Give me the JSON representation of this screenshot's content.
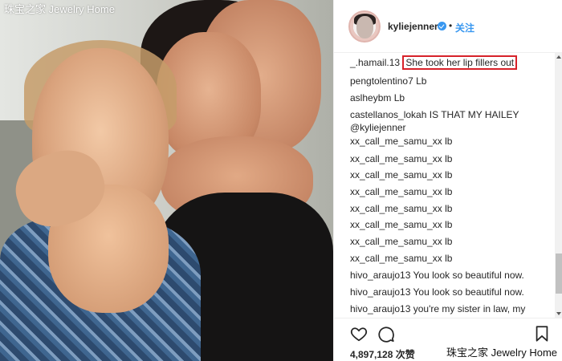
{
  "watermark": {
    "top_left": "珠宝之家 Jewelry Home",
    "bottom_right": "珠宝之家 Jewelry Home"
  },
  "post": {
    "username": "kyliejenner",
    "separator": "•",
    "follow_label": "关注",
    "verified": true,
    "accent_color": "#3897f0",
    "highlight_color": "#d7222a"
  },
  "comments": [
    {
      "user": "_.hamail.13",
      "text": "She took her lip fillers out",
      "highlighted": true
    },
    {
      "user": "pengtolentino7",
      "text": "Lb"
    },
    {
      "user": "aslheybm",
      "text": "Lb"
    },
    {
      "user": "castellanos_lokah",
      "text": "IS THAT MY HAILEY",
      "mention": "@kyliejenner"
    },
    {
      "user": "xx_call_me_samu_xx",
      "text": "lb"
    },
    {
      "user": "xx_call_me_samu_xx",
      "text": "lb"
    },
    {
      "user": "xx_call_me_samu_xx",
      "text": "lb"
    },
    {
      "user": "xx_call_me_samu_xx",
      "text": "lb"
    },
    {
      "user": "xx_call_me_samu_xx",
      "text": "lb"
    },
    {
      "user": "xx_call_me_samu_xx",
      "text": "lb"
    },
    {
      "user": "xx_call_me_samu_xx",
      "text": "lb"
    },
    {
      "user": "xx_call_me_samu_xx",
      "text": "lb"
    },
    {
      "user": "hivo_araujo13",
      "text": "You look so beautiful now."
    },
    {
      "user": "hivo_araujo13",
      "text": "You look so beautiful now."
    },
    {
      "user": "hivo_araujo13",
      "text": "you're my sister in law, my"
    }
  ],
  "actions": {
    "like_icon": "heart-icon",
    "comment_icon": "comment-icon",
    "save_icon": "bookmark-icon",
    "likes_count": "4,897,128",
    "likes_suffix": "次赞"
  }
}
